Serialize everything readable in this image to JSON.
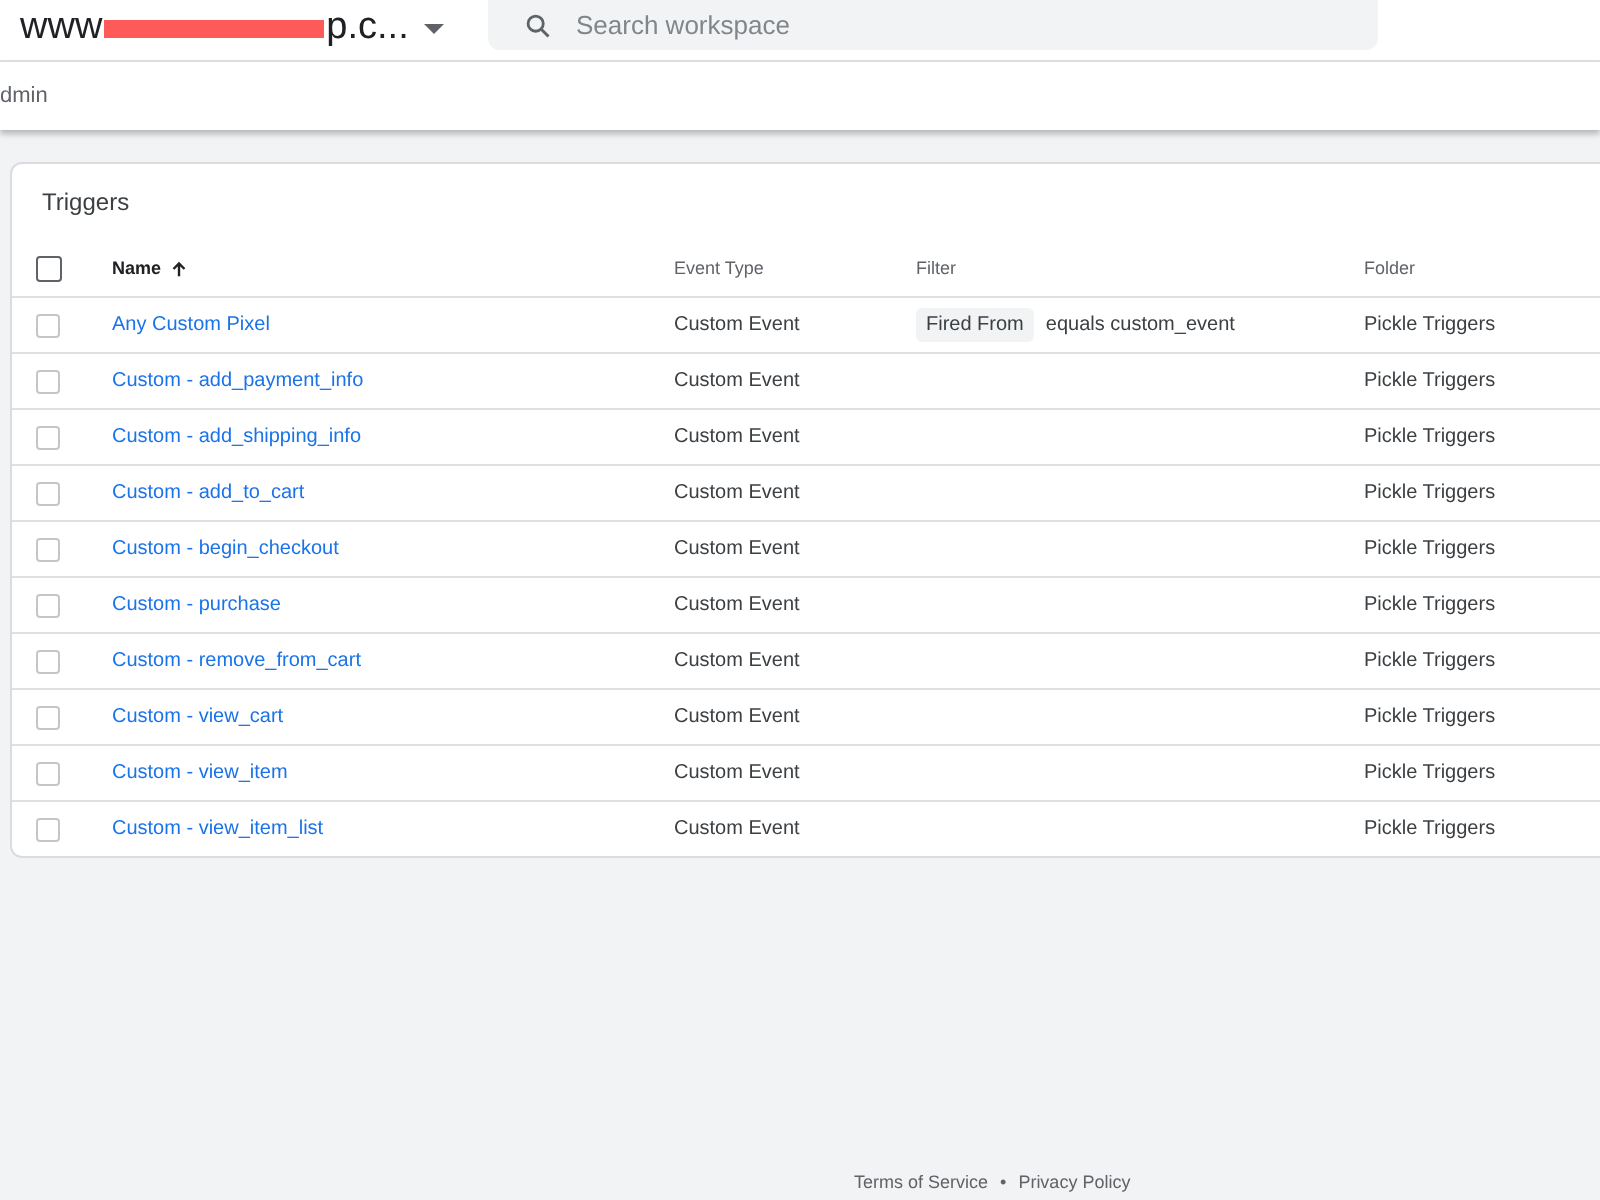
{
  "header": {
    "workspace_name_start": "www",
    "workspace_name_end": "p.c...",
    "search": {
      "placeholder": "Search workspace"
    }
  },
  "subbar": {
    "label": "dmin"
  },
  "triggers": {
    "title": "Triggers",
    "all_checked": false,
    "columns": [
      {
        "label": "Name",
        "sort_ascending": true
      },
      {
        "label": "Event Type"
      },
      {
        "label": "Filter"
      },
      {
        "label": "Folder"
      }
    ],
    "rows": [
      {
        "name": "Any Custom Pixel",
        "event_type": "Custom Event",
        "filter_chip": "Fired From",
        "filter_text": "equals custom_event",
        "folder": "Pickle Triggers",
        "checked": false
      },
      {
        "name": "Custom - add_payment_info",
        "event_type": "Custom Event",
        "folder": "Pickle Triggers",
        "checked": false
      },
      {
        "name": "Custom - add_shipping_info",
        "event_type": "Custom Event",
        "folder": "Pickle Triggers",
        "checked": false
      },
      {
        "name": "Custom - add_to_cart",
        "event_type": "Custom Event",
        "folder": "Pickle Triggers",
        "checked": false
      },
      {
        "name": "Custom - begin_checkout",
        "event_type": "Custom Event",
        "folder": "Pickle Triggers",
        "checked": false
      },
      {
        "name": "Custom - purchase",
        "event_type": "Custom Event",
        "folder": "Pickle Triggers",
        "checked": false
      },
      {
        "name": "Custom - remove_from_cart",
        "event_type": "Custom Event",
        "folder": "Pickle Triggers",
        "checked": false
      },
      {
        "name": "Custom - view_cart",
        "event_type": "Custom Event",
        "folder": "Pickle Triggers",
        "checked": false
      },
      {
        "name": "Custom - view_item",
        "event_type": "Custom Event",
        "folder": "Pickle Triggers",
        "checked": false
      },
      {
        "name": "Custom - view_item_list",
        "event_type": "Custom Event",
        "folder": "Pickle Triggers",
        "checked": false
      }
    ]
  },
  "footer": {
    "links": [
      "Terms of Service",
      "Privacy Policy"
    ],
    "separator": "•"
  }
}
